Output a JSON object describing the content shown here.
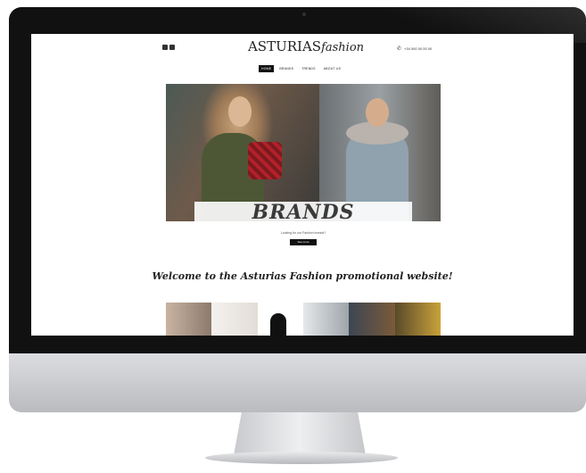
{
  "site": {
    "logo_main": "ASTURIAS",
    "logo_script": "fashion",
    "phone": "+34 000 00 00 00",
    "nav": [
      "Home",
      "Brands",
      "Trends",
      "About us"
    ],
    "hero": {
      "title": "BRANDS",
      "subtitle": "Looking for our Fashion brands?",
      "cta": "See more"
    },
    "welcome": "Welcome to the Asturias Fashion promotional website!"
  }
}
